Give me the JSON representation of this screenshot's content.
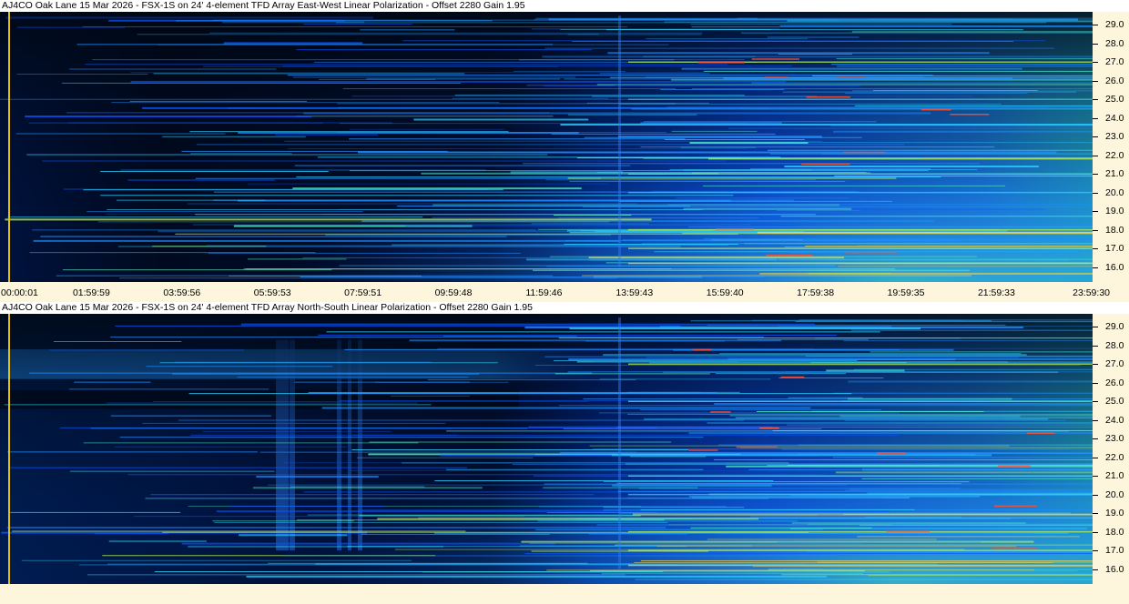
{
  "panels": [
    {
      "title": "AJ4CO Oak Lane 15 Mar 2026 - FSX-1S on 24' 4-element TFD Array East-West Linear Polarization  -  Offset 2280  Gain 1.95",
      "polarization": "east-west"
    },
    {
      "title": "AJ4CO Oak Lane 15 Mar 2026 - FSX-1S on 24' 4-element TFD Array North-South Linear Polarization  -  Offset 2280  Gain 1.95",
      "polarization": "north-south"
    }
  ],
  "time_ticks": [
    "00:00:01",
    "01:59:59",
    "03:59:56",
    "05:59:53",
    "07:59:51",
    "09:59:48",
    "11:59:46",
    "13:59:43",
    "15:59:40",
    "17:59:38",
    "19:59:35",
    "21:59:33",
    "23:59:30"
  ],
  "freq_ticks": [
    "29.0",
    "28.0",
    "27.0",
    "26.0",
    "25.0",
    "24.0",
    "23.0",
    "22.0",
    "21.0",
    "20.0",
    "19.0",
    "18.0",
    "17.0",
    "16.0"
  ],
  "colors": {
    "background": "#fdf6dc",
    "cursor": "#e8c000",
    "colormap": [
      "#000814",
      "#001a5c",
      "#0033b3",
      "#0a55ff",
      "#1f8fff",
      "#2ad0ff",
      "#4ff0c8",
      "#b8f050",
      "#ffd040",
      "#ff5030"
    ]
  },
  "chart_data": {
    "type": "heatmap",
    "panels": 2,
    "xlabel": "",
    "ylabel": "",
    "x_ticks": [
      "00:00:01",
      "01:59:59",
      "03:59:56",
      "05:59:53",
      "07:59:51",
      "09:59:48",
      "11:59:46",
      "13:59:43",
      "15:59:40",
      "17:59:38",
      "19:59:35",
      "21:59:33",
      "23:59:30"
    ],
    "y_ticks": [
      29.0,
      28.0,
      27.0,
      26.0,
      25.0,
      24.0,
      23.0,
      22.0,
      21.0,
      20.0,
      19.0,
      18.0,
      17.0,
      16.0
    ],
    "ylim": [
      15.2,
      29.7
    ],
    "grid": false,
    "legend": "none"
  }
}
